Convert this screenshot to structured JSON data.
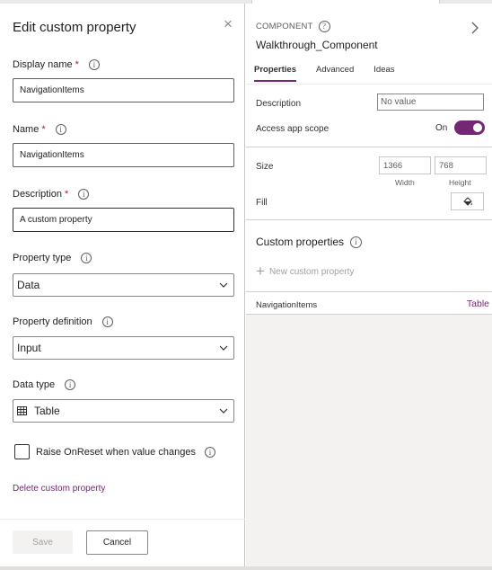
{
  "left_panel": {
    "title": "Edit custom property",
    "display_name": {
      "label": "Display name",
      "required": "*",
      "value": "NavigationItems"
    },
    "name": {
      "label": "Name",
      "required": "*",
      "value": "NavigationItems"
    },
    "description": {
      "label": "Description",
      "required": "*",
      "value": "A custom property"
    },
    "property_type": {
      "label": "Property type",
      "value": "Data"
    },
    "property_definition": {
      "label": "Property definition",
      "value": "Input"
    },
    "data_type": {
      "label": "Data type",
      "value": "Table",
      "icon": "table-icon"
    },
    "raise_onreset": {
      "label": "Raise OnReset when value changes",
      "checked": false
    },
    "delete_link": "Delete custom property",
    "save_label": "Save",
    "cancel_label": "Cancel",
    "info_glyph": "i",
    "close_glyph": "×"
  },
  "right_panel": {
    "section_label": "COMPONENT",
    "component_name": "Walkthrough_Component",
    "help_glyph": "?",
    "tabs": [
      {
        "label": "Properties",
        "active": true
      },
      {
        "label": "Advanced",
        "active": false
      },
      {
        "label": "Ideas",
        "active": false
      }
    ],
    "description": {
      "label": "Description",
      "value": "No value"
    },
    "access_app_scope": {
      "label": "Access app scope",
      "state": "On"
    },
    "size": {
      "label": "Size",
      "width": "1366",
      "height": "768",
      "width_label": "Width",
      "height_label": "Height"
    },
    "fill": {
      "label": "Fill",
      "icon": "paint-bucket-icon"
    },
    "custom_properties": {
      "title": "Custom properties",
      "new_label": "New custom property",
      "items": [
        {
          "name": "NavigationItems",
          "type": "Table"
        }
      ]
    }
  },
  "colors": {
    "accent": "#742774",
    "required": "#a4262c",
    "panel_bg": "#f3f2f1"
  }
}
